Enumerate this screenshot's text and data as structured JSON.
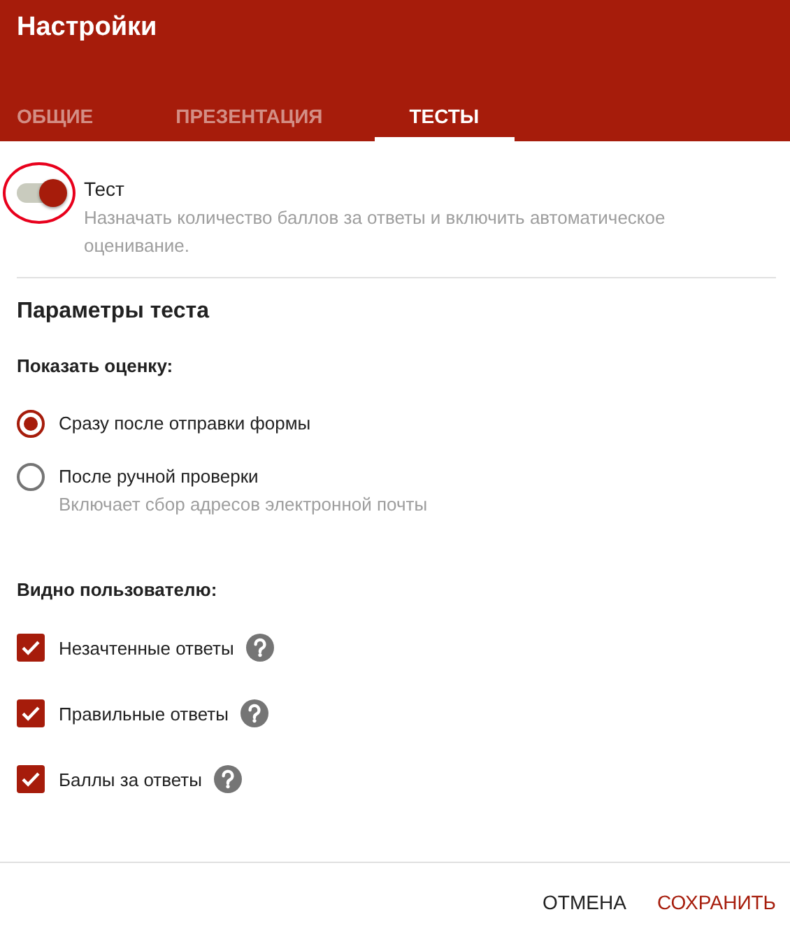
{
  "window": {
    "title": "Настройки"
  },
  "tabs": [
    {
      "label": "ОБЩИЕ",
      "selected": false
    },
    {
      "label": "ПРЕЗЕНТАЦИЯ",
      "selected": false
    },
    {
      "label": "ТЕСТЫ",
      "selected": true
    }
  ],
  "quiz_toggle": {
    "label": "Тест",
    "description": "Назначать количество баллов за ответы и включить автоматическое оценивание.",
    "on": true,
    "circled": true
  },
  "section_title": "Параметры теста",
  "show_grade": {
    "heading": "Показать оценку:",
    "options": [
      {
        "label": "Сразу после отправки формы",
        "selected": true
      },
      {
        "label": "После ручной проверки",
        "hint": "Включает сбор адресов электронной почты",
        "selected": false
      }
    ]
  },
  "visible_to_user": {
    "heading": "Видно пользователю:",
    "items": [
      {
        "label": "Незачтенные ответы",
        "checked": true
      },
      {
        "label": "Правильные ответы",
        "checked": true
      },
      {
        "label": "Баллы за ответы",
        "checked": true
      }
    ]
  },
  "buttons": [
    {
      "label": "ОТМЕНА",
      "kind": "plain"
    },
    {
      "label": "СОХРАНИТЬ",
      "kind": "primary"
    }
  ]
}
